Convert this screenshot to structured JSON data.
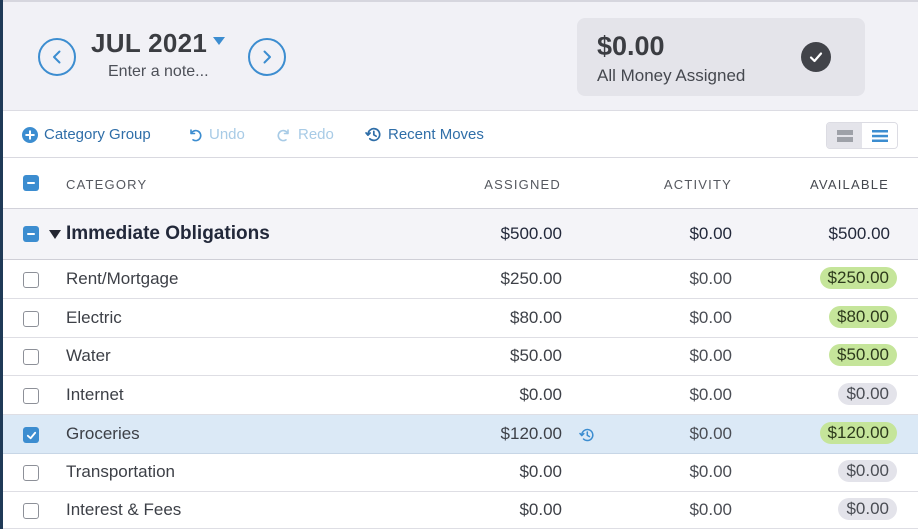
{
  "header": {
    "month": "JUL 2021",
    "note_placeholder": "Enter a note...",
    "to_be_assigned": {
      "amount": "$0.00",
      "label": "All Money Assigned",
      "status_icon": "check-circle-icon"
    }
  },
  "toolbar": {
    "category_group_label": "Category Group",
    "undo_label": "Undo",
    "redo_label": "Redo",
    "recent_moves_label": "Recent Moves",
    "view_modes": [
      "collapsed-view",
      "expanded-view"
    ],
    "active_view": "expanded-view"
  },
  "table": {
    "columns": {
      "category": "CATEGORY",
      "assigned": "ASSIGNED",
      "activity": "ACTIVITY",
      "available": "AVAILABLE"
    },
    "group": {
      "name": "Immediate Obligations",
      "assigned": "$500.00",
      "activity": "$0.00",
      "available": "$500.00"
    },
    "rows": [
      {
        "name": "Rent/Mortgage",
        "assigned": "$250.00",
        "activity": "$0.00",
        "available": "$250.00",
        "status": "funded",
        "checked": false
      },
      {
        "name": "Electric",
        "assigned": "$80.00",
        "activity": "$0.00",
        "available": "$80.00",
        "status": "funded",
        "checked": false
      },
      {
        "name": "Water",
        "assigned": "$50.00",
        "activity": "$0.00",
        "available": "$50.00",
        "status": "funded",
        "checked": false
      },
      {
        "name": "Internet",
        "assigned": "$0.00",
        "activity": "$0.00",
        "available": "$0.00",
        "status": "zero",
        "checked": false
      },
      {
        "name": "Groceries",
        "assigned": "$120.00",
        "activity": "$0.00",
        "available": "$120.00",
        "status": "funded",
        "checked": true
      },
      {
        "name": "Transportation",
        "assigned": "$0.00",
        "activity": "$0.00",
        "available": "$0.00",
        "status": "zero",
        "checked": false
      },
      {
        "name": "Interest & Fees",
        "assigned": "$0.00",
        "activity": "$0.00",
        "available": "$0.00",
        "status": "zero",
        "checked": false
      }
    ]
  },
  "colors": {
    "accent": "#3c8dd0",
    "funded_pill": "#c5e59a",
    "zero_pill": "#e3e3ea",
    "selected_row": "#dbe9f6"
  }
}
